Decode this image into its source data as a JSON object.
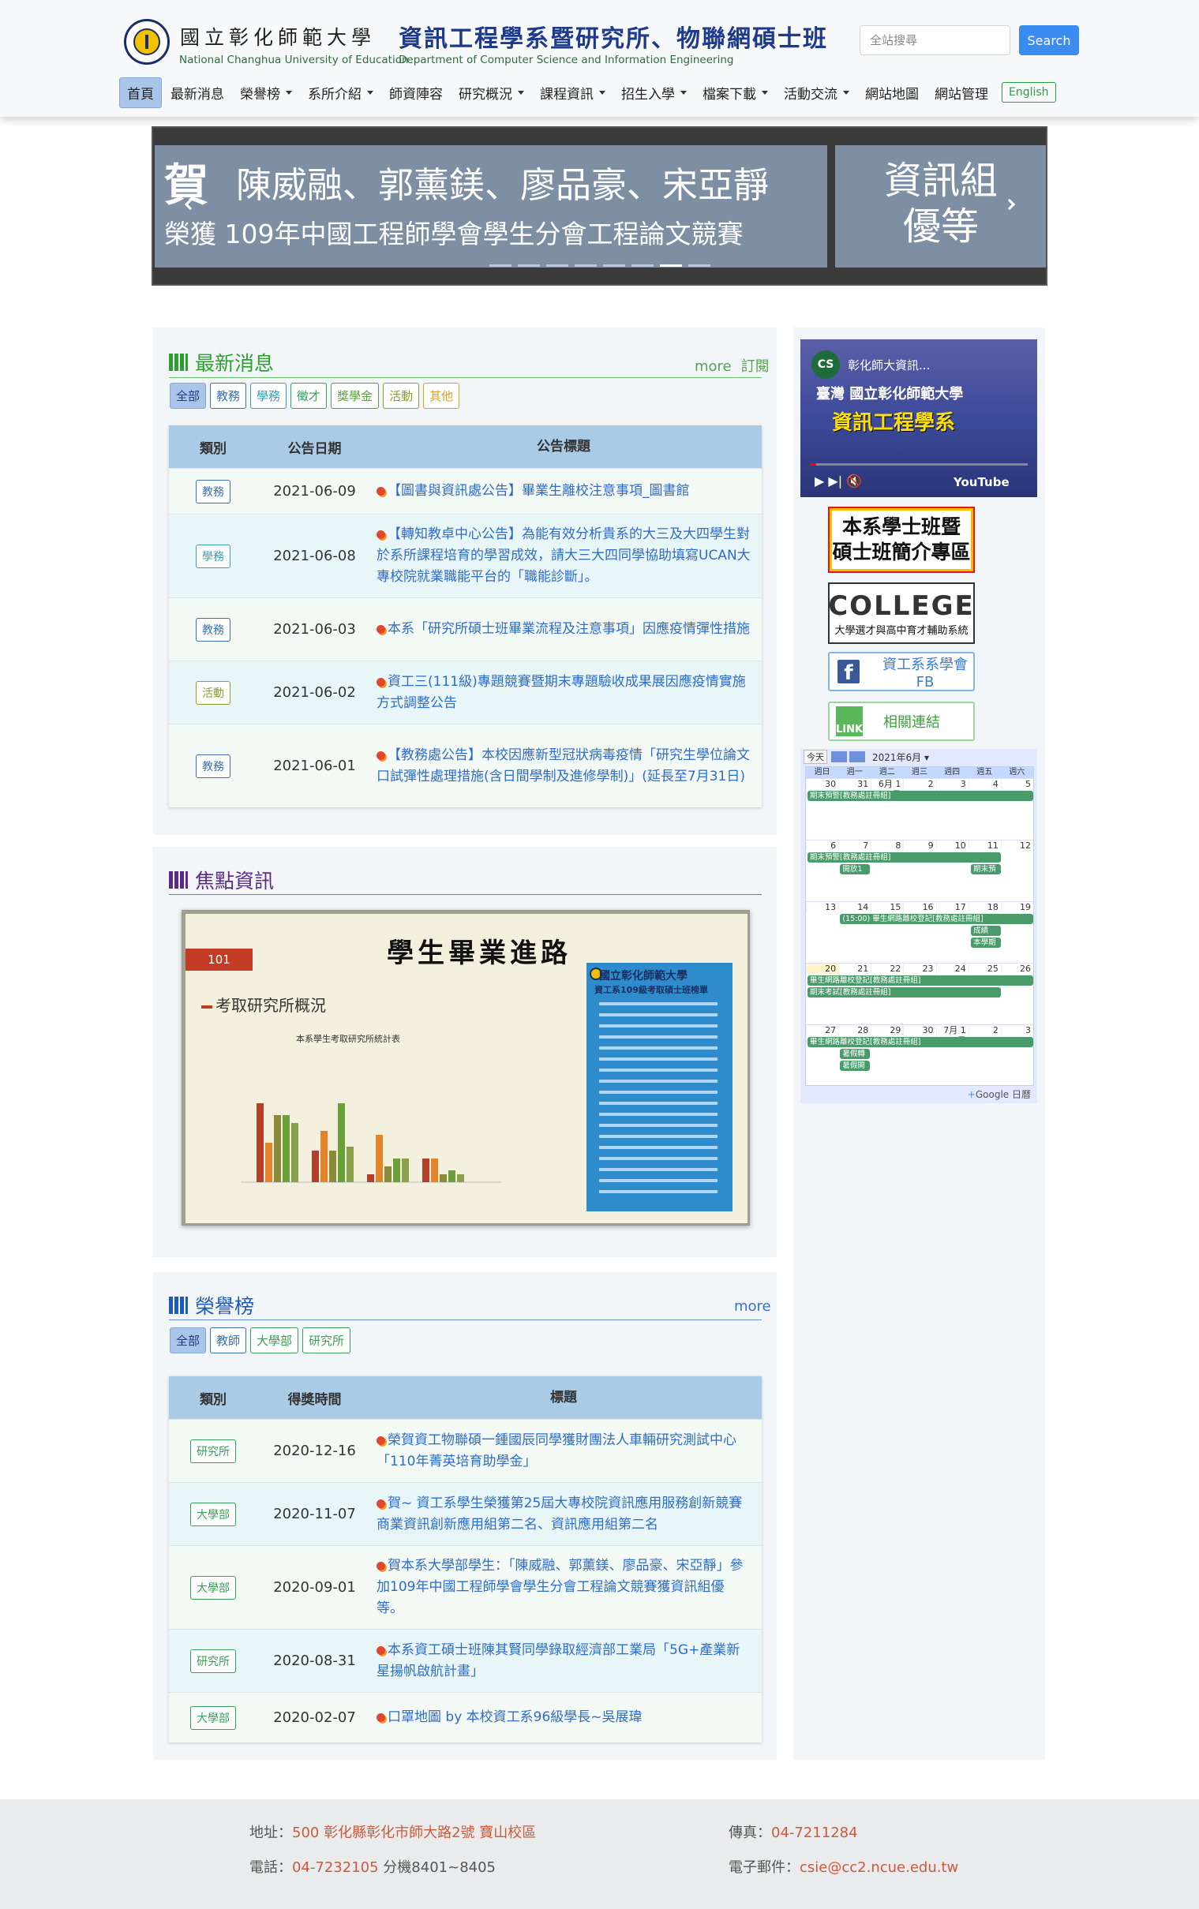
{
  "header": {
    "university_zh": "國立彰化師範大學",
    "university_en": "National Changhua University of Education",
    "department_zh": "資訊工程學系暨研究所、物聯網碩士班",
    "department_en": "Department of Computer Science and Information Engineering",
    "search_placeholder": "全站搜尋",
    "search_button": "Search"
  },
  "nav": {
    "items": [
      {
        "label": "首頁",
        "active": true,
        "dropdown": false
      },
      {
        "label": "最新消息",
        "dropdown": false
      },
      {
        "label": "榮譽榜",
        "dropdown": true
      },
      {
        "label": "系所介紹",
        "dropdown": true
      },
      {
        "label": "師資陣容",
        "dropdown": false
      },
      {
        "label": "研究概況",
        "dropdown": true
      },
      {
        "label": "課程資訊",
        "dropdown": true
      },
      {
        "label": "招生入學",
        "dropdown": true
      },
      {
        "label": "檔案下載",
        "dropdown": true
      },
      {
        "label": "活動交流",
        "dropdown": true
      },
      {
        "label": "網站地圖",
        "dropdown": false
      },
      {
        "label": "網站管理",
        "dropdown": false
      }
    ],
    "english": "English"
  },
  "carousel": {
    "he": "賀",
    "names": "陳威融、郭薰鎂、廖品豪、宋亞靜",
    "award": "榮獲 109年中國工程師學會學生分會工程論文競賽",
    "result_line1": "資訊組",
    "result_line2": "優等",
    "slide_count": 8,
    "active_slide": 6
  },
  "news": {
    "title": "最新消息",
    "more": "more",
    "subscribe": "訂閱",
    "filters": [
      {
        "label": "全部",
        "color": "#1d3e7a",
        "active": true
      },
      {
        "label": "教務",
        "color": "#3a6fb0"
      },
      {
        "label": "學務",
        "color": "#3aa0b0"
      },
      {
        "label": "徵才",
        "color": "#3aa05a"
      },
      {
        "label": "獎學金",
        "color": "#55a040"
      },
      {
        "label": "活動",
        "color": "#8aa02a"
      },
      {
        "label": "其他",
        "color": "#e0a020"
      }
    ],
    "columns": [
      "類別",
      "公告日期",
      "公告標題"
    ],
    "rows": [
      {
        "type": "教務",
        "color": "#3a6fb0",
        "date": "2021-06-09",
        "title": "【圖書與資訊處公告】畢業生離校注意事項_圖書館"
      },
      {
        "type": "學務",
        "color": "#3aa0b0",
        "date": "2021-06-08",
        "title": "【轉知教卓中心公告】為能有效分析貴系的大三及大四學生對於系所課程培育的學習成效，請大三大四同學協助填寫UCAN大專校院就業職能平台的「職能診斷」。"
      },
      {
        "type": "教務",
        "color": "#3a6fb0",
        "date": "2021-06-03",
        "title": "本系「研究所碩士班畢業流程及注意事項」因應疫情彈性措施"
      },
      {
        "type": "活動",
        "color": "#8aa02a",
        "date": "2021-06-02",
        "title": "資工三(111級)專題競賽暨期末專題驗收成果展因應疫情實施方式調整公告"
      },
      {
        "type": "教務",
        "color": "#3a6fb0",
        "date": "2021-06-01",
        "title": "【教務處公告】本校因應新型冠狀病毒疫情「研究生學位論文口試彈性處理措施(含日間學制及進修學制)」(延長至7月31日)"
      }
    ]
  },
  "focus": {
    "title": "焦點資訊",
    "slide_title": "學生畢業進路",
    "slide_badge": "101",
    "slide_subtitle": "考取研究所概況",
    "slide_chart_title": "本系學生考取研究所統計表",
    "poster_title": "國立彰化師範大學",
    "poster_subtitle": "資工系109級考取碩士班榜單"
  },
  "honor": {
    "title": "榮譽榜",
    "more": "more",
    "filters": [
      {
        "label": "全部",
        "color": "#1d3e7a",
        "active": true
      },
      {
        "label": "教師",
        "color": "#3a6fb0"
      },
      {
        "label": "大學部",
        "color": "#3aa05a"
      },
      {
        "label": "研究所",
        "color": "#3aa05a"
      }
    ],
    "columns": [
      "類別",
      "得獎時間",
      "標題"
    ],
    "rows": [
      {
        "type": "研究所",
        "color": "#3aa05a",
        "date": "2020-12-16",
        "title": "榮賀資工物聯碩一鍾國辰同學獲財團法人車輛研究測試中心「110年菁英培育助學金」"
      },
      {
        "type": "大學部",
        "color": "#3aa05a",
        "date": "2020-11-07",
        "title": "賀~ 資工系學生榮獲第25屆大專校院資訊應用服務創新競賽商業資訊創新應用組第二名、資訊應用組第二名"
      },
      {
        "type": "大學部",
        "color": "#3aa05a",
        "date": "2020-09-01",
        "title": "賀本系大學部學生：「陳威融、郭薰鎂、廖品豪、宋亞靜」參加109年中國工程師學會學生分會工程論文競賽獲資訊組優等。"
      },
      {
        "type": "研究所",
        "color": "#3aa05a",
        "date": "2020-08-31",
        "title": "本系資工碩士班陳其賢同學錄取經濟部工業局「5G+產業新星揚帆啟航計畫」"
      },
      {
        "type": "大學部",
        "color": "#3aa05a",
        "date": "2020-02-07",
        "title": "口罩地圖 by 本校資工系96級學長~吳展瑋"
      }
    ]
  },
  "sidebar": {
    "video": {
      "avatar": "CS",
      "title": "彰化師大資訊...",
      "banner1": "臺灣 國立彰化師範大學",
      "banner2": "資訊工程學系",
      "ctrl": "▶  ▶|  🔇",
      "logo": "YouTube"
    },
    "intro_line1": "本系學士班暨",
    "intro_line2": "碩士班簡介專區",
    "college_logo": "COLLEGE",
    "college_sub": "大學選才與高中育才輔助系統",
    "fb_label": "資工系系學會FB",
    "link_label": "相關連結",
    "link_icon": "LINK"
  },
  "calendar": {
    "today": "今天",
    "month": "2021年6月 ▾",
    "dow": [
      "週日",
      "週一",
      "週二",
      "週三",
      "週四",
      "週五",
      "週六"
    ],
    "weeks": [
      {
        "days": [
          "30",
          "31",
          "6月 1日",
          "2",
          "3",
          "4",
          "5"
        ],
        "events": [
          {
            "text": "期末預警[教務處註冊組]",
            "start": 0,
            "span": 7,
            "row": 0
          }
        ]
      },
      {
        "days": [
          "6",
          "7",
          "8",
          "9",
          "10",
          "11",
          "12"
        ],
        "events": [
          {
            "text": "期末預警[教務處註冊組]",
            "start": 0,
            "span": 6,
            "row": 0
          },
          {
            "text": "開放1",
            "start": 1,
            "span": 1,
            "row": 1
          },
          {
            "text": "期末預",
            "start": 5,
            "span": 1,
            "row": 1
          }
        ]
      },
      {
        "days": [
          "13",
          "14",
          "15",
          "16",
          "17",
          "18",
          "19"
        ],
        "events": [
          {
            "text": "(15:00) 畢生網路離校登記[教務處註冊組]",
            "start": 1,
            "span": 6,
            "row": 0
          },
          {
            "text": "成績",
            "start": 5,
            "span": 1,
            "row": 1
          },
          {
            "text": "本學期",
            "start": 5,
            "span": 1,
            "row": 2
          }
        ]
      },
      {
        "days": [
          "20",
          "21",
          "22",
          "23",
          "24",
          "25",
          "26"
        ],
        "today": 0,
        "events": [
          {
            "text": "畢生網路離校登記[教務處註冊組]",
            "start": 0,
            "span": 7,
            "row": 0
          },
          {
            "text": "期末考試[教務處註冊組]",
            "start": 0,
            "span": 6,
            "row": 1
          }
        ]
      },
      {
        "days": [
          "27",
          "28",
          "29",
          "30",
          "7月 1日",
          "2",
          "3"
        ],
        "events": [
          {
            "text": "畢生網路離校登記[教務處註冊組]",
            "start": 0,
            "span": 7,
            "row": 0
          },
          {
            "text": "暑假轉",
            "start": 1,
            "span": 1,
            "row": 1
          },
          {
            "text": "暑假開",
            "start": 1,
            "span": 1,
            "row": 2
          }
        ]
      }
    ],
    "footer": "Google 日曆"
  },
  "footer": {
    "address_label": "地址：",
    "address": "500 彰化縣彰化市師大路2號 寶山校區",
    "phone_label": "電話：",
    "phone": "04-7232105",
    "phone_ext": " 分機8401~8405",
    "fax_label": "傳真：",
    "fax": "04-7211284",
    "email_label": "電子郵件：",
    "email": "csie@cc2.ncue.edu.tw"
  },
  "colors": {
    "news_accent": "#2ca02c",
    "focus_accent": "#5a2a8a",
    "honor_accent": "#1e5ab8",
    "link_blue": "#2f6cc9",
    "table_header": "#a9cbe6"
  }
}
